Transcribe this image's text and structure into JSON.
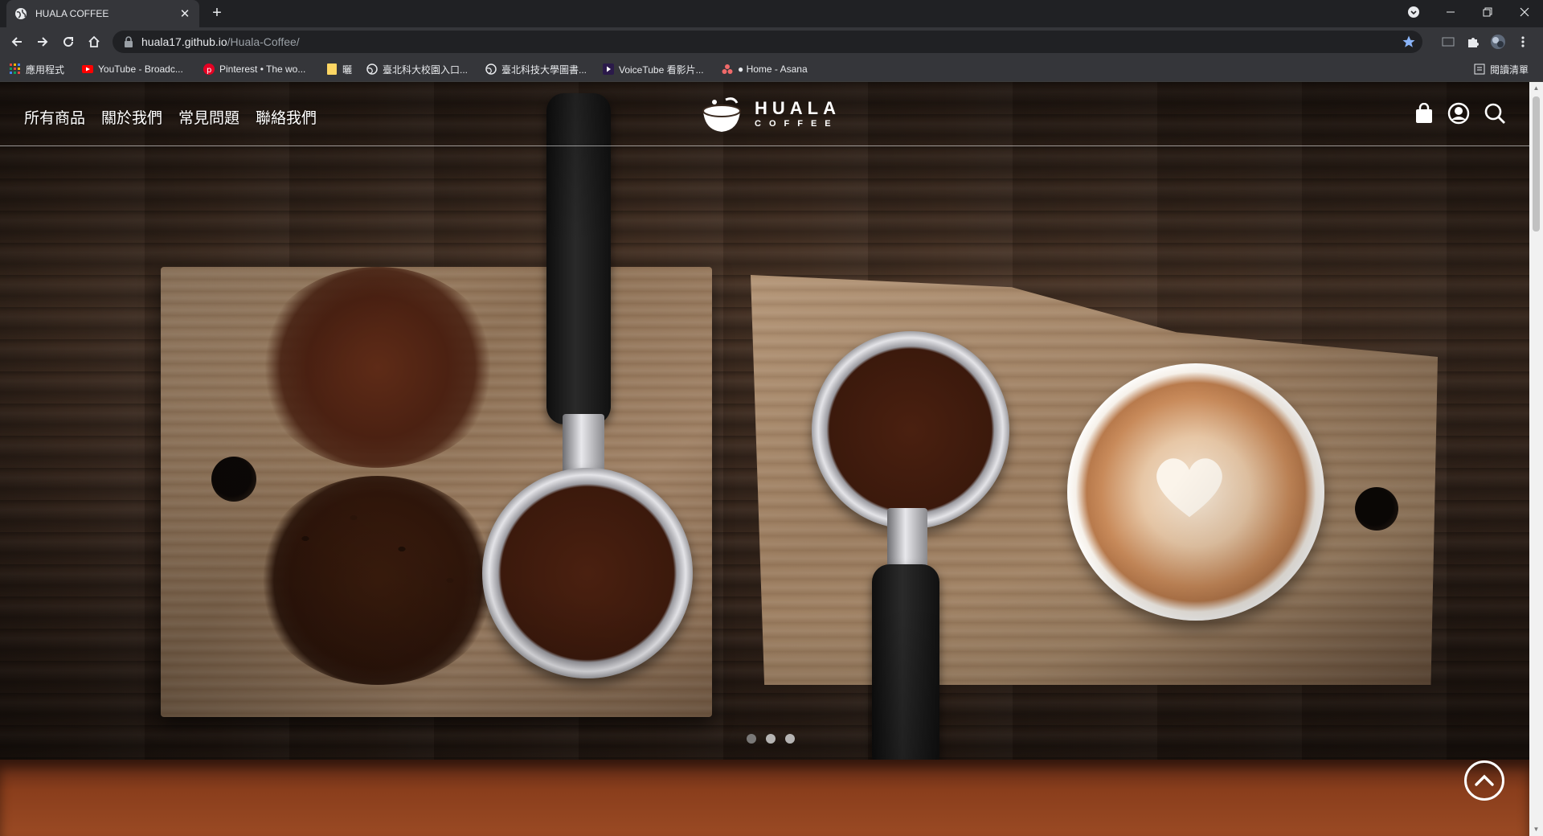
{
  "browser": {
    "tab_title": "HUALA COFFEE",
    "tab_close": "✕",
    "new_tab": "+",
    "url_host": "huala17.github.io",
    "url_path": "/Huala-Coffee/",
    "bookmarks": [
      {
        "label": "應用程式",
        "icon": "apps-grid-icon"
      },
      {
        "label": "YouTube - Broadc...",
        "icon": "youtube-icon"
      },
      {
        "label": "Pinterest • The wo...",
        "icon": "pinterest-icon"
      },
      {
        "label": "曬",
        "icon": "folder-icon"
      },
      {
        "label": "臺北科大校園入口...",
        "icon": "globe-icon"
      },
      {
        "label": "臺北科技大學圖書...",
        "icon": "globe-icon"
      },
      {
        "label": "VoiceTube 看影片...",
        "icon": "voicetube-icon"
      },
      {
        "label": "● Home - Asana",
        "icon": "asana-icon"
      }
    ],
    "reading_list": "閱讀清單"
  },
  "site": {
    "nav": [
      "所有商品",
      "關於我們",
      "常見問題",
      "聯絡我們"
    ],
    "logo": {
      "main": "HUALA",
      "sub": "COFFEE"
    },
    "carousel": {
      "slide_count": 3,
      "active_index": 0
    }
  },
  "colors": {
    "chrome_dark": "#202124",
    "chrome_mid": "#35363a",
    "star_blue": "#8ab4f8",
    "leather": "#8a3e1c"
  }
}
